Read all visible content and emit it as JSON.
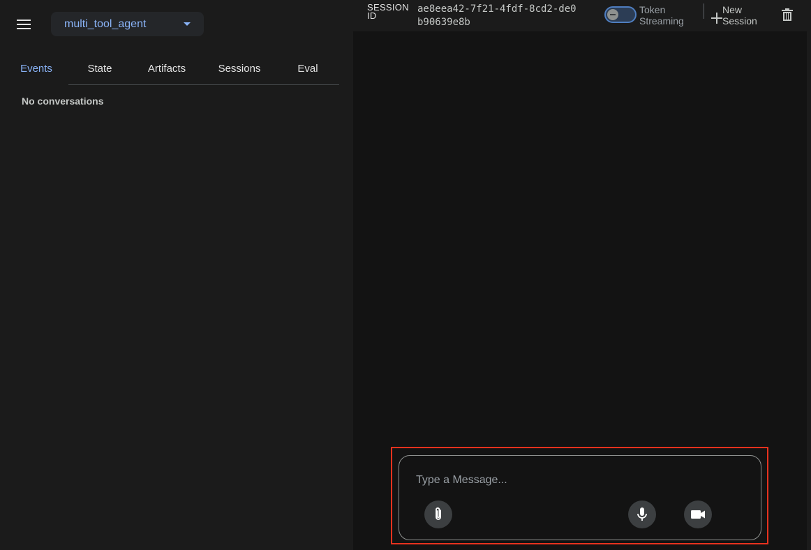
{
  "sidebar": {
    "app_name": "multi_tool_agent",
    "tabs": [
      {
        "label": "Events",
        "active": true
      },
      {
        "label": "State",
        "active": false
      },
      {
        "label": "Artifacts",
        "active": false
      },
      {
        "label": "Sessions",
        "active": false
      },
      {
        "label": "Eval",
        "active": false
      }
    ],
    "empty_message": "No conversations"
  },
  "topbar": {
    "session_label": "SESSION ID",
    "session_id": "ae8eea42-7f21-4fdf-8cd2-de0b90639e8b",
    "token_streaming_label": "Token Streaming",
    "token_streaming_enabled": false,
    "new_session_label": "New Session"
  },
  "composer": {
    "placeholder": "Type a Message..."
  },
  "icons": {
    "menu": "menu-icon",
    "dropdown": "chevron-down-icon",
    "new_session": "plus-icon",
    "delete": "trash-icon",
    "attach": "paperclip-icon",
    "mic": "microphone-icon",
    "video": "video-camera-icon"
  },
  "colors": {
    "accent": "#8ab4f8",
    "highlight": "#e8321e",
    "panel_bg": "#1b1b1b",
    "chat_bg": "#131313"
  }
}
